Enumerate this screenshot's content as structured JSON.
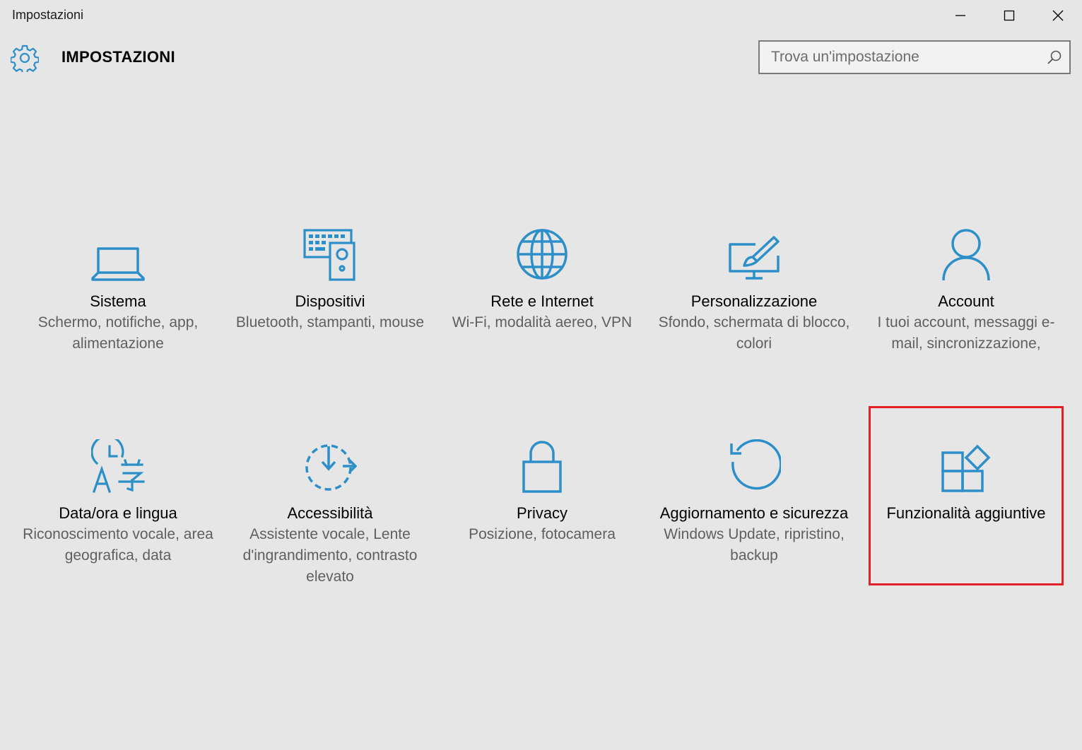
{
  "window": {
    "title": "Impostazioni",
    "controls": [
      "minimize-icon",
      "maximize-icon",
      "close-icon"
    ]
  },
  "header": {
    "title": "IMPOSTAZIONI",
    "icon": "gear-icon"
  },
  "search": {
    "placeholder": "Trova un'impostazione",
    "value": "",
    "icon": "search-icon"
  },
  "accent_color": "#2d8fc9",
  "highlight_color": "#e3202a",
  "categories": [
    {
      "label": "Sistema",
      "desc": "Schermo, notifiche, app, alimentazione",
      "icon": "laptop-icon"
    },
    {
      "label": "Dispositivi",
      "desc": "Bluetooth, stampanti, mouse",
      "icon": "devices-icon"
    },
    {
      "label": "Rete e Internet",
      "desc": "Wi-Fi, modalità aereo, VPN",
      "icon": "globe-icon"
    },
    {
      "label": "Personalizzazione",
      "desc": "Sfondo, schermata di blocco, colori",
      "icon": "paintbrush-icon"
    },
    {
      "label": "Account",
      "desc": "I tuoi account, messaggi e-mail, sincronizzazione,",
      "icon": "person-icon"
    },
    {
      "label": "Data/ora e lingua",
      "desc": "Riconoscimento vocale, area geografica, data",
      "icon": "time-language-icon"
    },
    {
      "label": "Accessibilità",
      "desc": "Assistente vocale, Lente d'ingrandimento, contrasto elevato",
      "icon": "ease-of-access-icon"
    },
    {
      "label": "Privacy",
      "desc": "Posizione, fotocamera",
      "icon": "lock-icon"
    },
    {
      "label": "Aggiornamento e sicurezza",
      "desc": "Windows Update, ripristino, backup",
      "icon": "update-icon"
    },
    {
      "label": "Funzionalità aggiuntive",
      "desc": "",
      "icon": "extras-icon",
      "highlighted": true
    }
  ]
}
